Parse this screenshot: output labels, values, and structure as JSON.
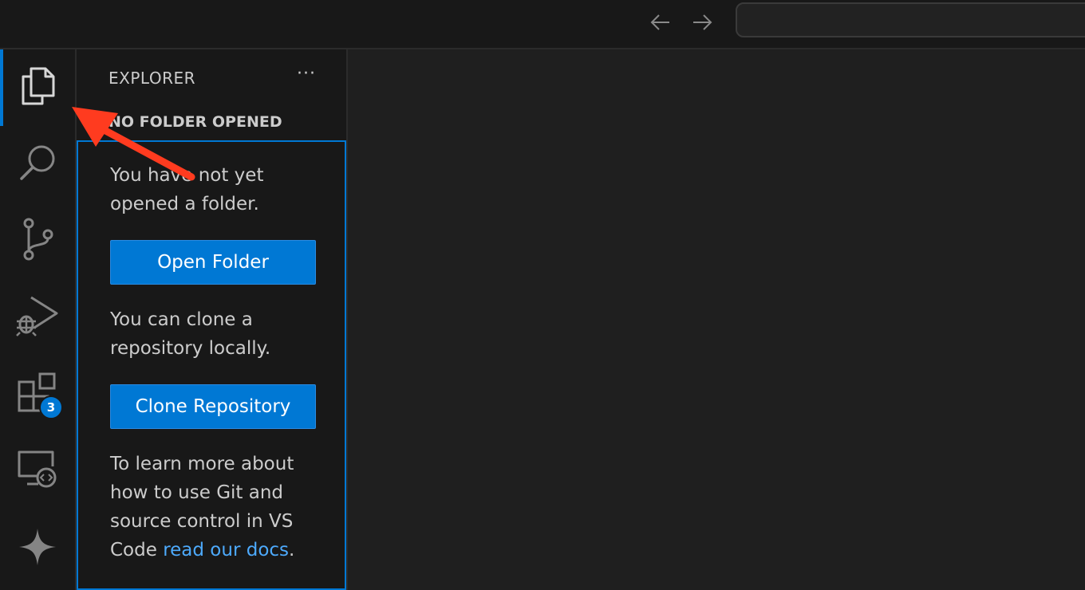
{
  "titlebar": {
    "back_icon": "arrow-left-icon",
    "forward_icon": "arrow-right-icon",
    "command_center_text": ""
  },
  "activity_bar": {
    "items": [
      {
        "name": "explorer",
        "icon": "files-icon",
        "active": true
      },
      {
        "name": "search",
        "icon": "search-icon",
        "active": false
      },
      {
        "name": "source-control",
        "icon": "source-control-icon",
        "active": false
      },
      {
        "name": "run-and-debug",
        "icon": "run-debug-icon",
        "active": false
      },
      {
        "name": "extensions",
        "icon": "extensions-icon",
        "active": false
      },
      {
        "name": "remote-explorer",
        "icon": "remote-explorer-icon",
        "active": false
      },
      {
        "name": "copilot",
        "icon": "sparkle-icon",
        "active": false
      }
    ],
    "extensions_badge": "3"
  },
  "sidebar": {
    "title": "EXPLORER",
    "more_actions": "···",
    "section_header": "NO FOLDER OPENED",
    "no_folder_text": "You have not yet opened a folder.",
    "open_folder_label": "Open Folder",
    "clone_text": "You can clone a repository locally.",
    "clone_label": "Clone Repository",
    "learn_more_text": "To learn more about how to use Git and source control in VS Code ",
    "docs_link": "read our docs",
    "learn_more_suffix": "."
  },
  "colors": {
    "accent": "#0078d4",
    "link": "#4daafc",
    "annotation_arrow": "#ff3b1f",
    "sidebar_bg": "#181818",
    "editor_bg": "#1f1f1f"
  }
}
